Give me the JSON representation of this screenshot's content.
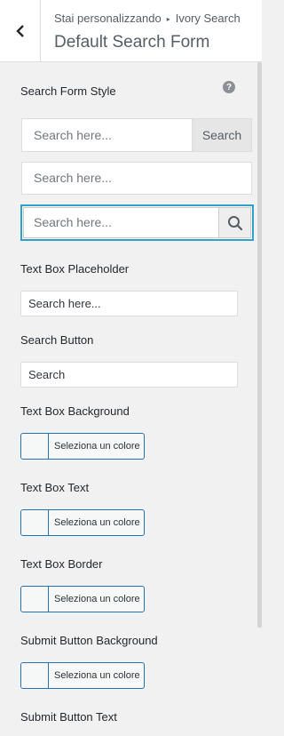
{
  "header": {
    "breadcrumb_prefix": "Stai personalizzando",
    "breadcrumb_separator": "▸",
    "breadcrumb_section": "Ivory Search",
    "title": "Default Search Form",
    "back_icon": "chevron-left-icon"
  },
  "search_form_style": {
    "label": "Search Form Style",
    "help_glyph": "?",
    "options": [
      {
        "placeholder": "Search here...",
        "button_label": "Search"
      },
      {
        "placeholder": "Search here..."
      },
      {
        "placeholder": "Search here...",
        "button_icon": "search-icon",
        "selected": true
      }
    ]
  },
  "text_box_placeholder": {
    "label": "Text Box Placeholder",
    "value": "Search here..."
  },
  "search_button": {
    "label": "Search Button",
    "value": "Search"
  },
  "color_controls": [
    {
      "label": "Text Box Background",
      "button_label": "Seleziona un colore"
    },
    {
      "label": "Text Box Text",
      "button_label": "Seleziona un colore"
    },
    {
      "label": "Text Box Border",
      "button_label": "Seleziona un colore"
    },
    {
      "label": "Submit Button Background",
      "button_label": "Seleziona un colore"
    }
  ],
  "submit_button_text": {
    "label": "Submit Button Text"
  },
  "colors": {
    "accent": "#2ea2cc",
    "color_button_border": "#2271b1"
  }
}
